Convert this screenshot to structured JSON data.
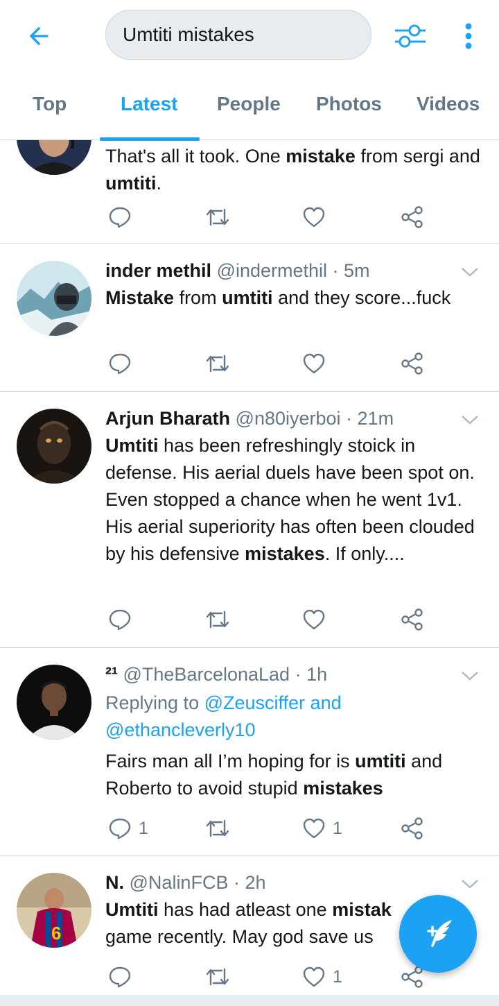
{
  "search": {
    "query": "Umtiti mistakes"
  },
  "tabs": [
    {
      "label": "Top"
    },
    {
      "label": "Latest"
    },
    {
      "label": "People"
    },
    {
      "label": "Photos"
    },
    {
      "label": "Videos"
    }
  ],
  "active_tab": "Latest",
  "colors": {
    "accent": "#1da1f2",
    "muted": "#657786",
    "text": "#14171a",
    "divider": "#ccd6dd"
  },
  "tweets": [
    {
      "name": "",
      "handle": "",
      "time": "",
      "text_parts": [
        "That's all it took. One ",
        "mistake",
        " from sergi and ",
        "umtiti",
        "."
      ],
      "counts": {
        "reply": "",
        "retweet": "",
        "like": ""
      }
    },
    {
      "name": "inder methil",
      "handle": "@indermethil",
      "time": "5m",
      "text_parts": [
        "Mistake",
        " from ",
        "umtiti",
        " and they score...fuck"
      ],
      "counts": {
        "reply": "",
        "retweet": "",
        "like": ""
      }
    },
    {
      "name": "Arjun Bharath",
      "handle": "@n80iyerboi",
      "time": "21m",
      "text_parts": [
        "Umtiti",
        " has been refreshingly stoick in defense. His aerial duels have been spot on. Even stopped a chance when he went 1v1. His aerial superiority has often been clouded by his defensive ",
        "mistakes",
        ". If only...."
      ],
      "counts": {
        "reply": "",
        "retweet": "",
        "like": ""
      }
    },
    {
      "name": "²¹",
      "handle": "@TheBarcelonaLad",
      "time": "1h",
      "replying_prefix": "Replying to ",
      "replying_to": "@Zeusciffer and @ethancleverly10",
      "text_parts": [
        "Fairs man all I’m hoping for is ",
        "umtiti",
        " and Roberto to avoid stupid ",
        "mistakes"
      ],
      "counts": {
        "reply": "1",
        "retweet": "",
        "like": "1"
      }
    },
    {
      "name": "N.",
      "handle": "@NalinFCB",
      "time": "2h",
      "text_parts": [
        "Umtiti",
        " has had atleast one ",
        "mistak",
        "game recently. May god save us"
      ],
      "counts": {
        "reply": "",
        "retweet": "",
        "like": "1"
      }
    }
  ],
  "icons": [
    "back-arrow-icon",
    "filter-icon",
    "more-vert-icon",
    "reply-icon",
    "retweet-icon",
    "like-icon",
    "share-icon",
    "chevron-down-icon",
    "compose-icon"
  ]
}
